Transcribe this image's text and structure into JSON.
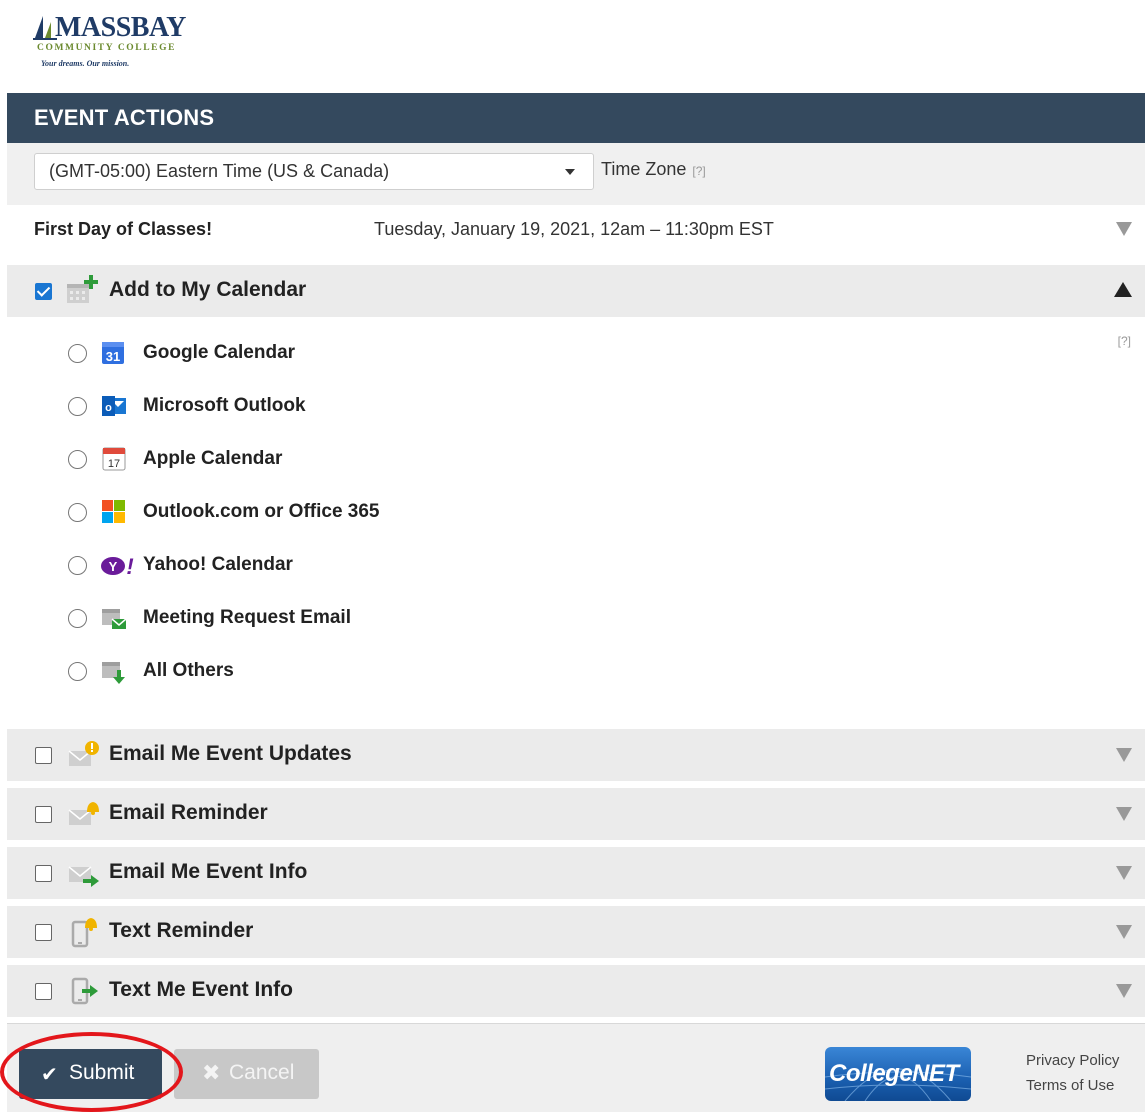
{
  "logo": {
    "name": "MASSBAY",
    "subtitle": "COMMUNITY COLLEGE",
    "tagline": "Your dreams. Our mission."
  },
  "header": {
    "title": "EVENT ACTIONS"
  },
  "timezone": {
    "value": "(GMT-05:00) Eastern Time (US & Canada)",
    "label": "Time Zone",
    "help": "[?]"
  },
  "event": {
    "name": "First Day of Classes!",
    "datetime": "Tuesday, January 19, 2021, 12am – 11:30pm EST"
  },
  "add_calendar": {
    "label": "Add to My Calendar",
    "checked": true,
    "help": "[?]",
    "options": [
      {
        "label": "Google Calendar",
        "icon": "google-calendar-icon"
      },
      {
        "label": "Microsoft Outlook",
        "icon": "outlook-icon"
      },
      {
        "label": "Apple Calendar",
        "icon": "apple-calendar-icon"
      },
      {
        "label": "Outlook.com or Office 365",
        "icon": "office365-icon"
      },
      {
        "label": "Yahoo! Calendar",
        "icon": "yahoo-icon"
      },
      {
        "label": "Meeting Request Email",
        "icon": "meeting-email-icon"
      },
      {
        "label": "All Others",
        "icon": "download-calendar-icon"
      }
    ]
  },
  "sections": [
    {
      "label": "Email Me Event Updates",
      "icon": "email-alert-icon",
      "checked": false
    },
    {
      "label": "Email Reminder",
      "icon": "email-bell-icon",
      "checked": false
    },
    {
      "label": "Email Me Event Info",
      "icon": "email-forward-icon",
      "checked": false
    },
    {
      "label": "Text Reminder",
      "icon": "phone-bell-icon",
      "checked": false
    },
    {
      "label": "Text Me Event Info",
      "icon": "phone-forward-icon",
      "checked": false
    }
  ],
  "footer": {
    "submit_label": "Submit",
    "cancel_label": "Cancel",
    "brand": "CollegeNET",
    "privacy_label": "Privacy Policy",
    "terms_label": "Terms of Use"
  },
  "colors": {
    "header": "#34495e",
    "checkbox": "#1976d2",
    "highlight": "#e3161b"
  }
}
